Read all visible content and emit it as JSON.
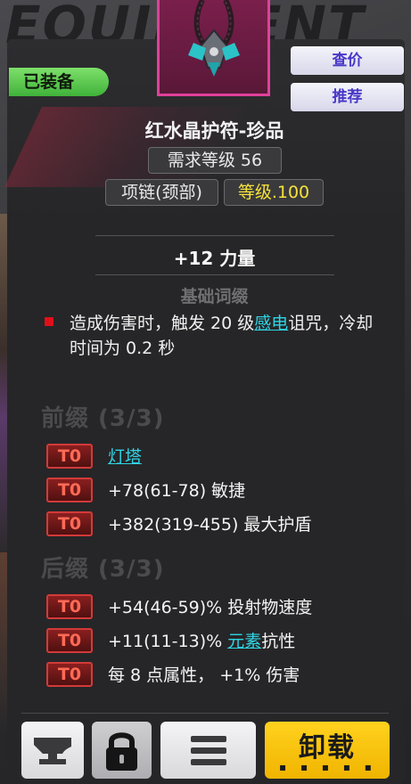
{
  "background": {
    "title": "EQUIPMENT"
  },
  "item": {
    "name": "红水晶护符-珍品",
    "required_level": "需求等级 56",
    "slot": "项链(颈部)",
    "item_level": "等级.100",
    "equipped_label": "已装备",
    "rarity_color": "#e0409a"
  },
  "actions": {
    "check_price": "查价",
    "recommend": "推荐",
    "unequip": "卸载"
  },
  "main_stat": "+12 力量",
  "base_affix": {
    "label": "基础词缀",
    "desc_pre": "造成伤害时，触发 20 级",
    "desc_link": "感电",
    "desc_post": "诅咒，冷却时间为 0.2 秒"
  },
  "prefix": {
    "title": "前缀 (3/3)",
    "rows": [
      {
        "tier": "T0",
        "text": "",
        "link": "灯塔",
        "suffix": ""
      },
      {
        "tier": "T0",
        "text": "+78(61-78) 敏捷",
        "link": "",
        "suffix": ""
      },
      {
        "tier": "T0",
        "text": "+382(319-455) 最大护盾",
        "link": "",
        "suffix": ""
      }
    ]
  },
  "suffix": {
    "title": "后缀 (3/3)",
    "rows": [
      {
        "tier": "T0",
        "text": "+54(46-59)% 投射物速度",
        "link": "",
        "suffix": ""
      },
      {
        "tier": "T0",
        "text": "+11(11-13)% ",
        "link": "元素",
        "suffix": "抗性"
      },
      {
        "tier": "T0",
        "text": "每 8 点属性， +1% 伤害",
        "link": "",
        "suffix": ""
      }
    ]
  },
  "bottom_bar": [
    "anvil-icon",
    "lock-icon",
    "list-icon",
    "unequip-button"
  ],
  "colors": {
    "link": "#30d4e4",
    "equipped": "#3fb23a",
    "tier_border": "#d23a3a",
    "item_level": "#f5e13a"
  }
}
